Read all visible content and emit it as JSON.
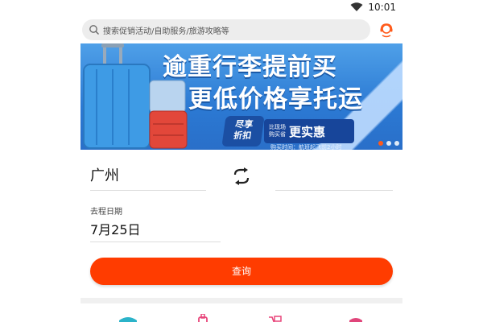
{
  "status_bar": {
    "time": "10:01"
  },
  "search": {
    "placeholder": "搜索促销活动/自助服务/旅游攻略等"
  },
  "banner": {
    "line1": "逾重行李提前买",
    "line2": "更低价格享托运",
    "badge_left": [
      "尽享",
      "折扣"
    ],
    "badge_right_small": [
      "比现场",
      "购买省"
    ],
    "badge_right_big": "更实惠",
    "footer": "购买时间：航班起飞前2小时",
    "slides": 3,
    "active_slide": 1
  },
  "booking": {
    "from_city": "广州",
    "to_city": "",
    "date_label": "去程日期",
    "date_value": "7月25日",
    "query_label": "查询"
  },
  "colors": {
    "accent": "#ff3c00",
    "banner_blue": "#2b79d3"
  }
}
